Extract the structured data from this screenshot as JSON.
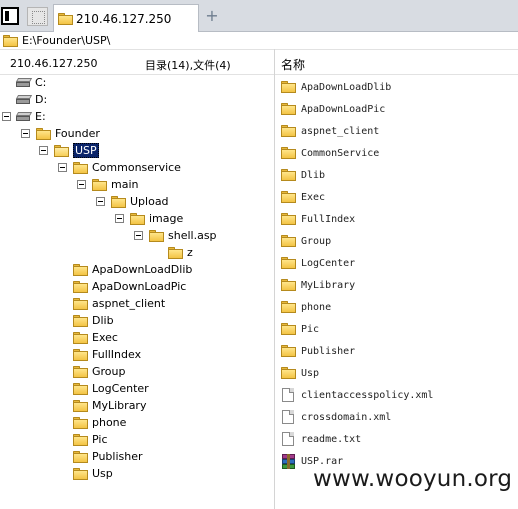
{
  "tabs": {
    "active_label": "210.46.127.250",
    "new_tab_symbol": "+"
  },
  "path_bar": {
    "path": "E:\\Founder\\USP\\"
  },
  "header": {
    "host": "210.46.127.250",
    "count_text": "目录(14),文件(4)",
    "name_column": "名称"
  },
  "tree": {
    "drive_c": "C:",
    "drive_d": "D:",
    "drive_e": "E:",
    "founder": "Founder",
    "usp": "USP",
    "commonservice": "Commonservice",
    "main": "main",
    "upload": "Upload",
    "image": "image",
    "shell": "shell.asp",
    "z": "z",
    "children": [
      "ApaDownLoadDlib",
      "ApaDownLoadPic",
      "aspnet_client",
      "Dlib",
      "Exec",
      "FullIndex",
      "Group",
      "LogCenter",
      "MyLibrary",
      "phone",
      "Pic",
      "Publisher",
      "Usp"
    ]
  },
  "file_list": {
    "folders": [
      "ApaDownLoadDlib",
      "ApaDownLoadPic",
      "aspnet_client",
      "CommonService",
      "Dlib",
      "Exec",
      "FullIndex",
      "Group",
      "LogCenter",
      "MyLibrary",
      "phone",
      "Pic",
      "Publisher",
      "Usp"
    ],
    "files": [
      "clientaccesspolicy.xml",
      "crossdomain.xml",
      "readme.txt"
    ],
    "archive": "USP.rar"
  },
  "watermark": "www.wooyun.org",
  "colors": {
    "selection": "#0a246a",
    "folder": "#f3c445",
    "tabbar": "#d8dce2"
  }
}
